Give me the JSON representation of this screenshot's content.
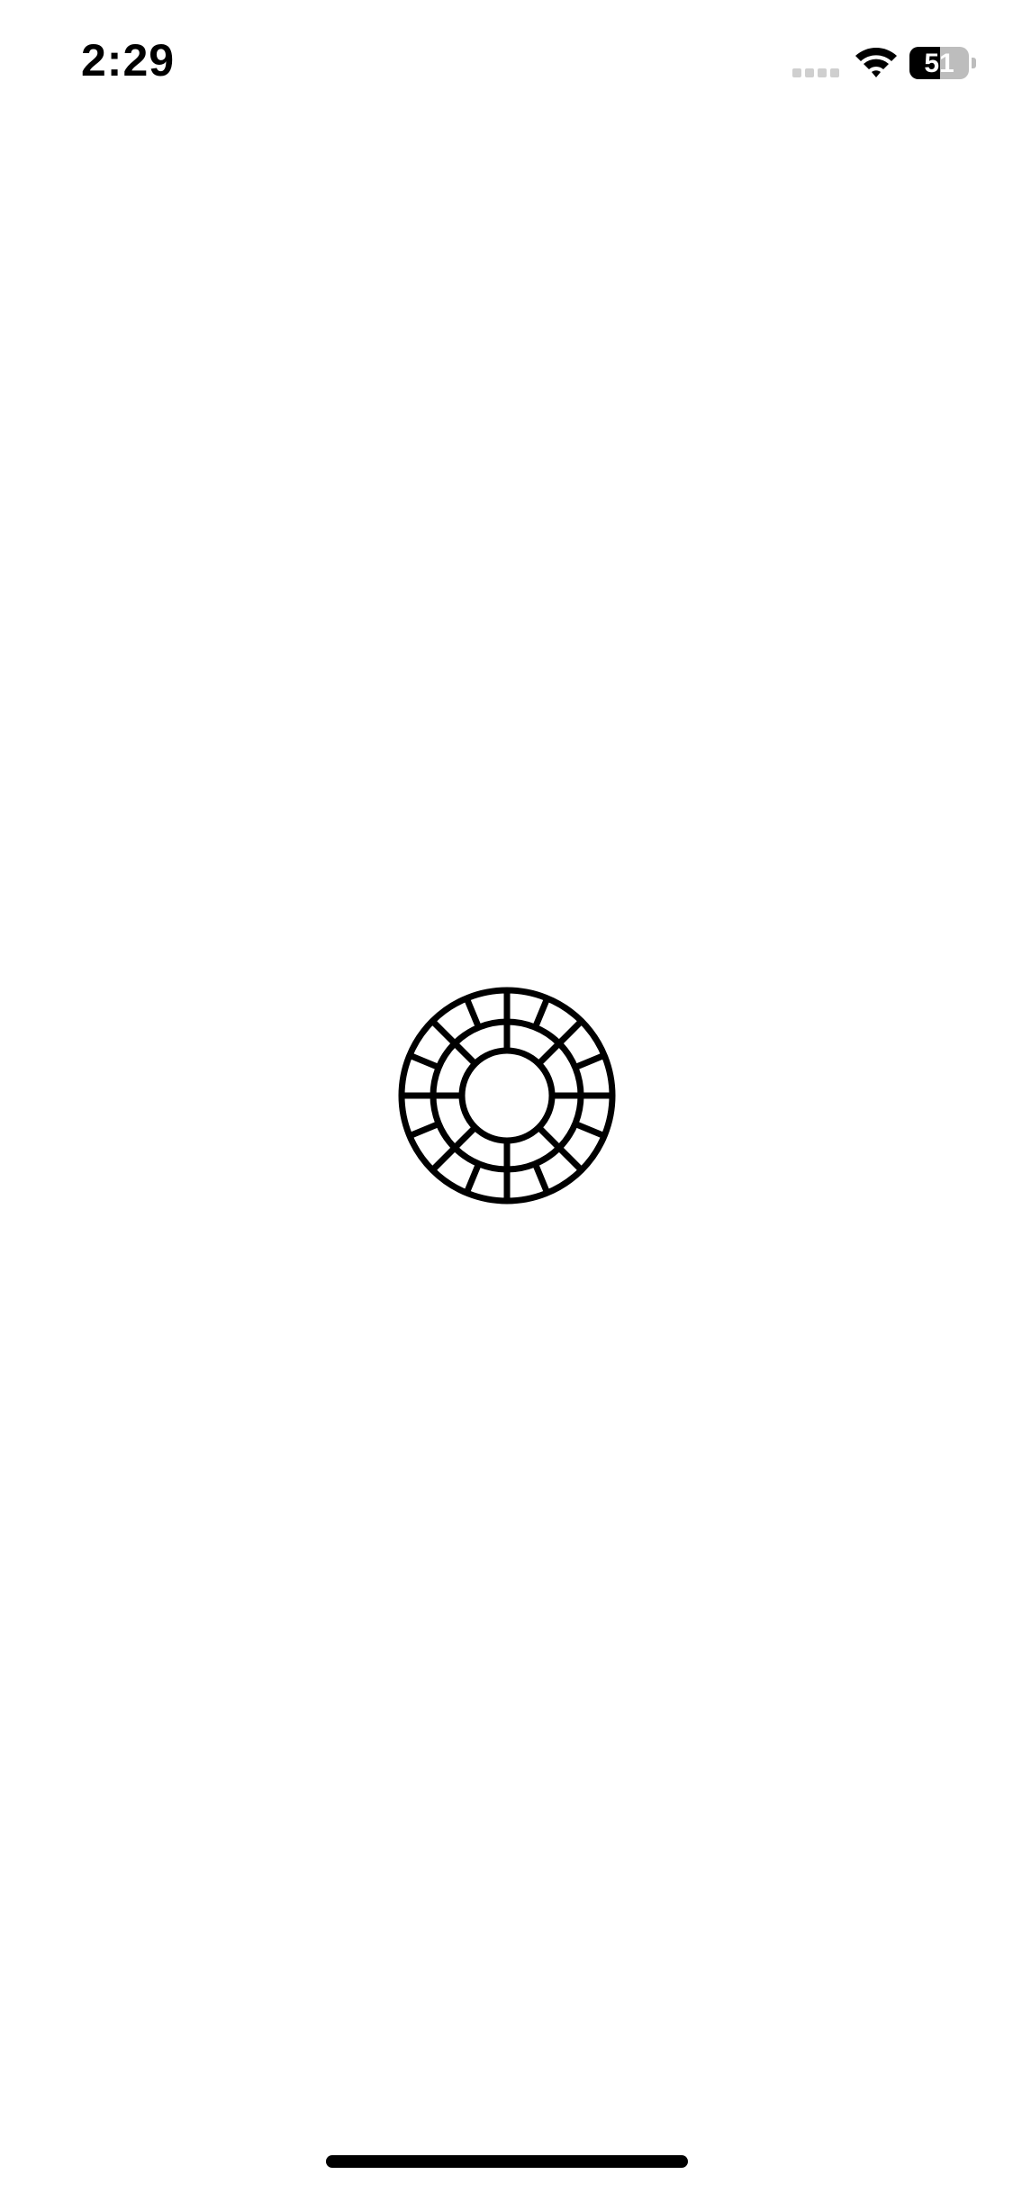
{
  "status_bar": {
    "time": "2:29",
    "battery_level": "51",
    "battery_fraction": 0.51,
    "icons": [
      "cellular-signal-icon",
      "wifi-icon",
      "battery-icon"
    ]
  },
  "splash": {
    "logo_icon": "vsco-logo-icon",
    "logo_color": "#000000",
    "background_color": "#ffffff"
  }
}
